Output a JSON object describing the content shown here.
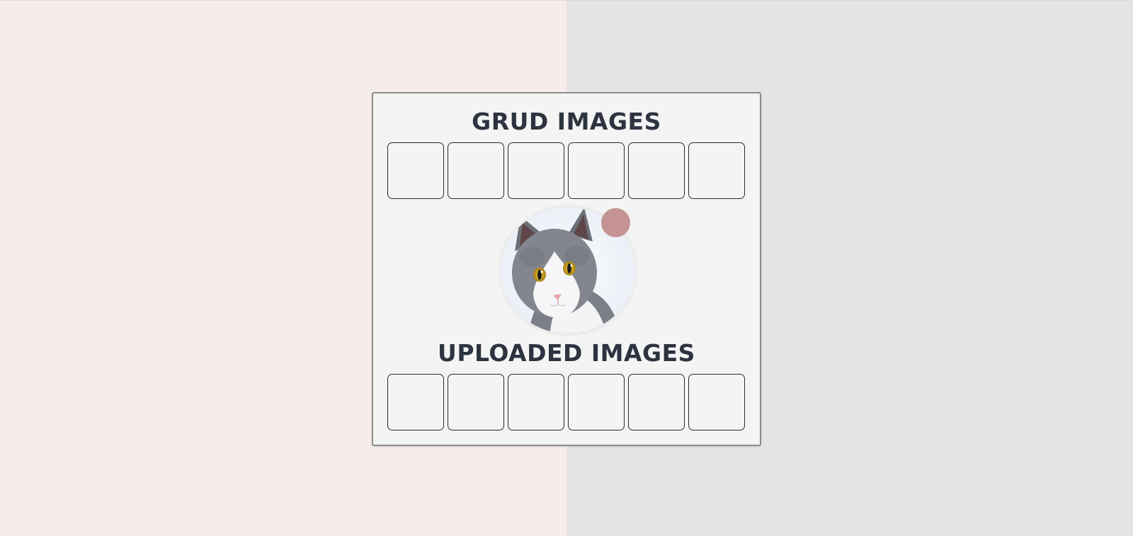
{
  "grud": {
    "title": "GRUD IMAGES",
    "slot_count": 6
  },
  "avatar": {
    "image": "cat-photo"
  },
  "uploaded": {
    "title": "UPLOADED IMAGES",
    "slot_count": 6
  },
  "colors": {
    "bg_left": "#f6ece9",
    "bg_right": "#e4e4e4",
    "panel": "#f4f4f4",
    "title": "#2e3340",
    "upload_dot": "#c59393"
  }
}
